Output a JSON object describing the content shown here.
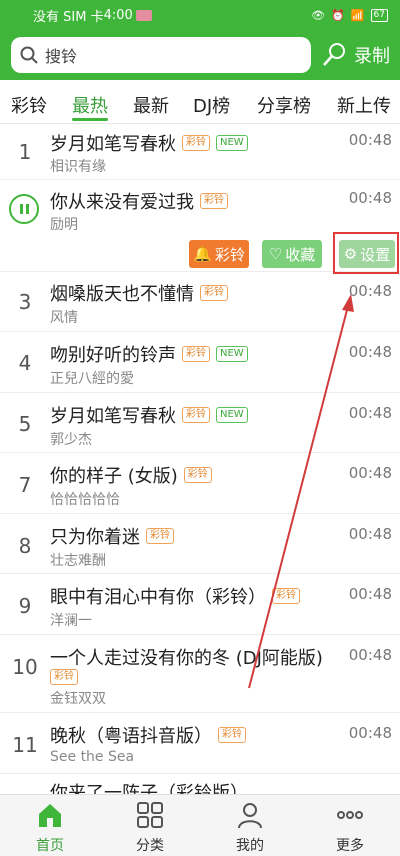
{
  "status_bar": {
    "carrier": "没有 SIM 卡",
    "time": "4:00",
    "battery": "67"
  },
  "search": {
    "placeholder": "搜铃",
    "record_label": "录制"
  },
  "tabs": [
    "彩铃",
    "最热",
    "最新",
    "DJ榜",
    "分享榜",
    "新上传"
  ],
  "active_tab": "最热",
  "songs": [
    {
      "rank": "1",
      "title": "岁月如笔写春秋",
      "artist": "相识有缘",
      "duration": "00:48",
      "tags": [
        "彩铃",
        "NEW"
      ]
    },
    {
      "rank": "",
      "title": "你从来没有爱过我",
      "artist": "励明",
      "duration": "00:48",
      "tags": [
        "彩铃"
      ],
      "playing": true
    },
    {
      "rank": "3",
      "title": "烟嗓版天也不懂情",
      "artist": "风情",
      "duration": "00:48",
      "tags": [
        "彩铃"
      ]
    },
    {
      "rank": "4",
      "title": "吻别好听的铃声",
      "artist": "正兒八經的愛",
      "duration": "00:48",
      "tags": [
        "彩铃",
        "NEW"
      ]
    },
    {
      "rank": "5",
      "title": "岁月如笔写春秋",
      "artist": "郭少杰",
      "duration": "00:48",
      "tags": [
        "彩铃",
        "NEW"
      ]
    },
    {
      "rank": "7",
      "title": "你的样子 (女版)",
      "artist": "恰恰恰恰恰",
      "duration": "00:48",
      "tags": [
        "彩铃"
      ]
    },
    {
      "rank": "8",
      "title": "只为你着迷",
      "artist": "壮志难酬",
      "duration": "00:48",
      "tags": [
        "彩铃"
      ]
    },
    {
      "rank": "9",
      "title": "眼中有泪心中有你（彩铃）",
      "artist": "洋澜一",
      "duration": "00:48",
      "tags": [
        "彩铃"
      ]
    },
    {
      "rank": "10",
      "title": "一个人走过没有你的冬 (DJ阿能版)",
      "artist": "金钰双双",
      "duration": "00:48",
      "tags": [
        "彩铃"
      ]
    },
    {
      "rank": "11",
      "title": "晚秋（粤语抖音版）",
      "artist": "See the Sea",
      "duration": "00:48",
      "tags": [
        "彩铃"
      ]
    },
    {
      "rank": "",
      "title": "你来了一阵子（彩铃版）",
      "artist": "",
      "duration": "",
      "tags": []
    }
  ],
  "actions": {
    "ringtone": "彩铃",
    "favorite": "收藏",
    "settings": "设置"
  },
  "bottom_nav": [
    "首页",
    "分类",
    "我的",
    "更多"
  ],
  "colors": {
    "brand": "#3fb63a",
    "accent_orange": "#f07a2e",
    "highlight": "#e03a3a"
  }
}
